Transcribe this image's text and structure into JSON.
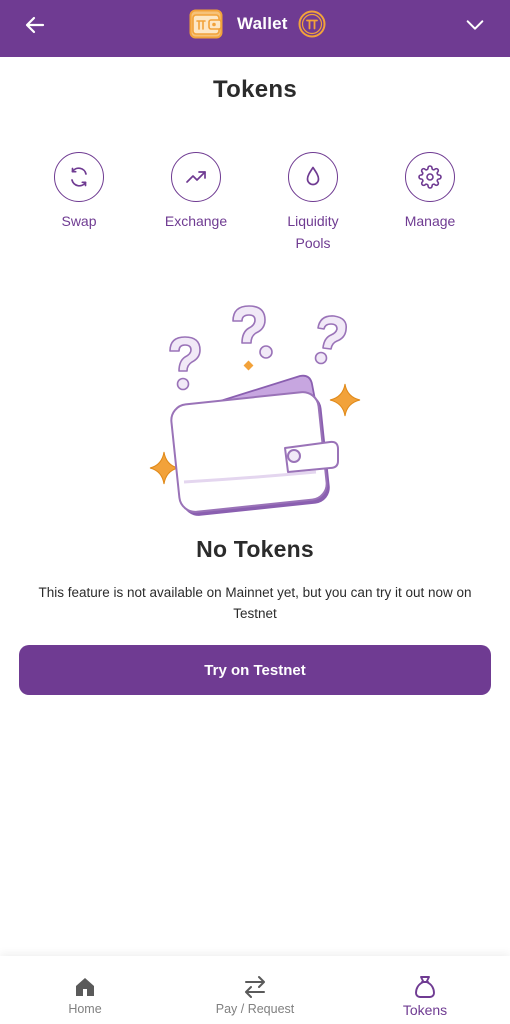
{
  "header": {
    "title": "Wallet",
    "back_icon": "arrow-left-icon",
    "app_icon": "wallet-icon",
    "coin_icon": "pi-coin-icon",
    "menu_icon": "chevron-down-icon"
  },
  "page": {
    "title": "Tokens"
  },
  "actions": [
    {
      "label": "Swap",
      "icon": "swap-icon"
    },
    {
      "label": "Exchange",
      "icon": "trending-up-icon"
    },
    {
      "label": "Liquidity Pools",
      "icon": "droplet-icon"
    },
    {
      "label": "Manage",
      "icon": "gear-icon"
    }
  ],
  "empty_state": {
    "title": "No Tokens",
    "description": "This feature is not available on Mainnet yet, but you can try it out now on Testnet",
    "cta_label": "Try on Testnet"
  },
  "bottom_nav": [
    {
      "label": "Home",
      "icon": "home-icon",
      "active": false
    },
    {
      "label": "Pay / Request",
      "icon": "transfer-arrows-icon",
      "active": false
    },
    {
      "label": "Tokens",
      "icon": "money-bag-icon",
      "active": true
    }
  ],
  "colors": {
    "brand_purple": "#6f3b92",
    "accent_orange": "#f2a23a",
    "text_dark": "#2b2b2b",
    "text_muted": "#808080"
  }
}
